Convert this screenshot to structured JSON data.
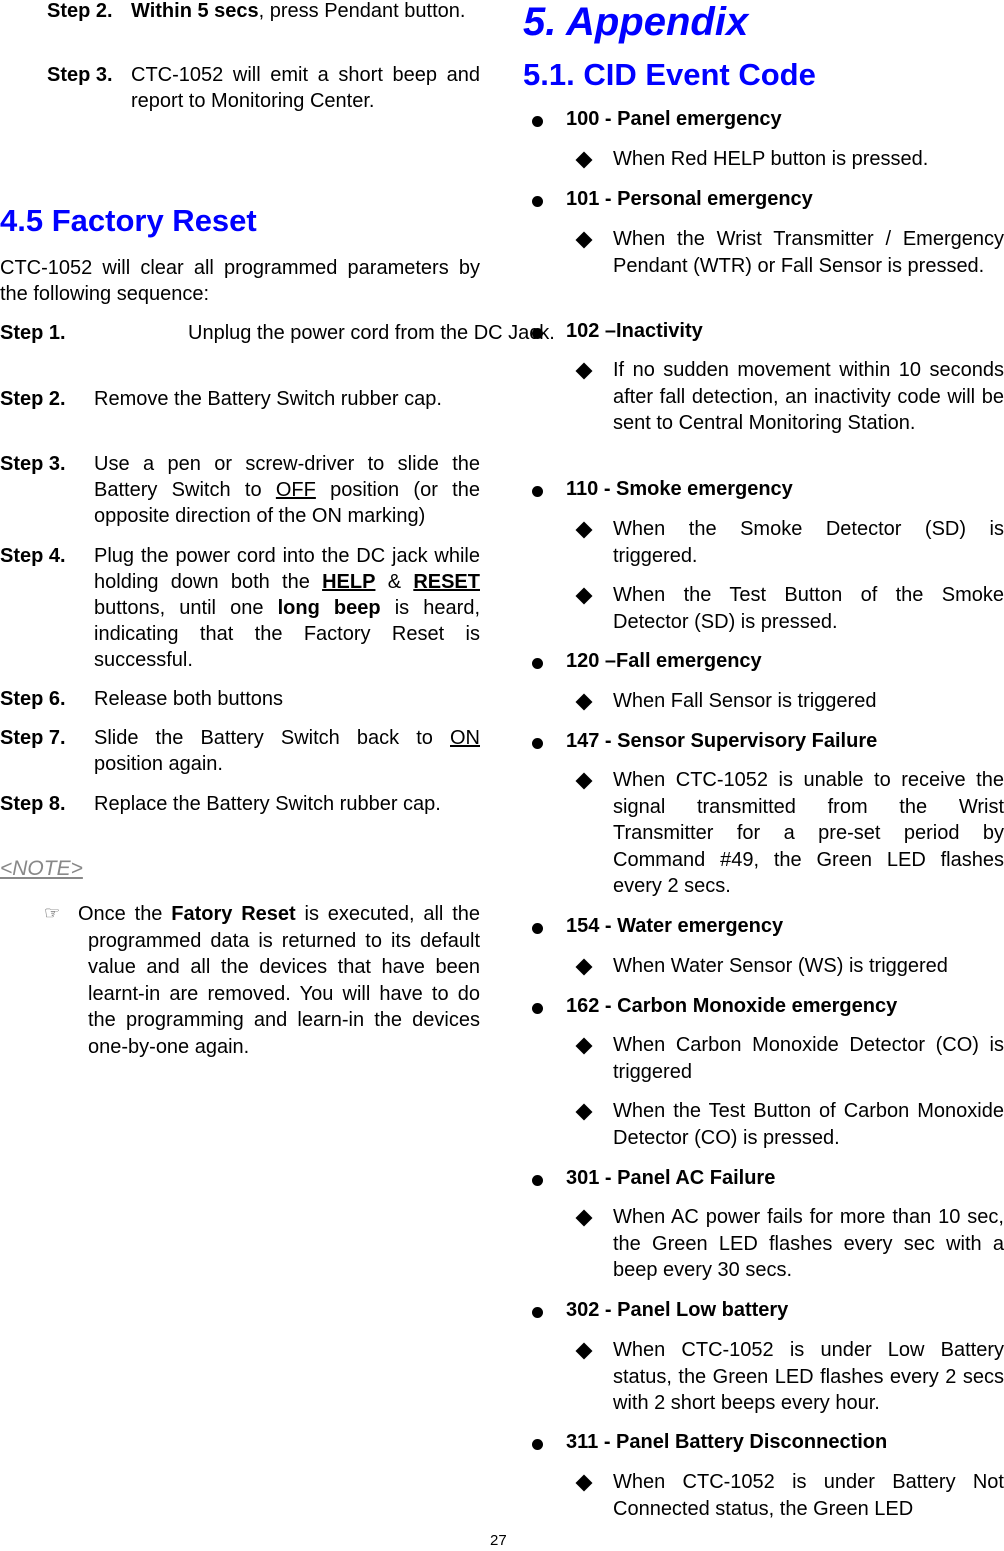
{
  "left_column": {
    "pendant_steps": [
      {
        "label": "Step 2.",
        "bold_text": "Within 5 secs",
        "text": ", press Pendant button."
      },
      {
        "label": "Step 3.",
        "text": "CTC-1052 will emit a short beep and report to Monitoring Center."
      }
    ],
    "factory_reset": {
      "heading": "4.5 Factory Reset",
      "intro": "CTC-1052 will clear all programmed parameters by the following sequence:",
      "steps": [
        {
          "label": "Step 1.",
          "text": "Unplug the power cord from the DC Jack."
        },
        {
          "label": "Step 2.",
          "text": "Remove the Battery Switch rubber cap."
        },
        {
          "label": "Step 3.",
          "text_before": "Use a pen or screw-driver to slide the Battery Switch to ",
          "underlined": "OFF",
          "text_after": " position (or the opposite direction of the ON marking)"
        },
        {
          "label": "Step 4.",
          "text_1": "Plug the power cord into the DC jack while holding down both the ",
          "bold_underlined_1": "HELP",
          "text_2": " & ",
          "bold_underlined_2": "RESET",
          "text_3": " buttons, until one ",
          "bold": "long beep",
          "text_4": " is heard, indicating that the Factory Reset is successful."
        },
        {
          "label": "Step 6.",
          "text": "Release both buttons"
        },
        {
          "label": "Step 7.",
          "text_before": "Slide the Battery Switch back to ",
          "underlined": "ON",
          "text_after": " position again."
        },
        {
          "label": "Step 8.",
          "text": "Replace the Battery Switch rubber cap."
        }
      ],
      "note": {
        "label": "<NOTE>",
        "icon": "pointing-hand-icon",
        "icon_glyph": "☞",
        "text_before": "Once the ",
        "bold": "Fatory Reset",
        "text_after": " is executed, all the programmed data is returned to its default value and all the devices that have been learnt-in are removed.  You will have to do the programming and learn-in the devices one-by-one again."
      }
    }
  },
  "right_column": {
    "heading": "5. Appendix",
    "subheading": "5.1. CID Event Code",
    "events": [
      {
        "title": "100 - Panel emergency",
        "descriptions": [
          "When Red HELP button is pressed."
        ]
      },
      {
        "title": "101 - Personal emergency",
        "descriptions": [
          "When the Wrist Transmitter / Emergency Pendant (WTR) or Fall Sensor is pressed."
        ]
      },
      {
        "title": "102 –Inactivity",
        "descriptions": [
          "If no sudden movement within 10 seconds after fall detection, an inactivity code will be sent to Central Monitoring Station."
        ]
      },
      {
        "title": "110 - Smoke emergency",
        "descriptions": [
          "When the Smoke Detector (SD) is triggered.",
          "When the Test Button of the Smoke Detector (SD) is pressed."
        ]
      },
      {
        "title": "120 –Fall emergency",
        "descriptions": [
          "When Fall Sensor is triggered"
        ]
      },
      {
        "title": "147 - Sensor Supervisory Failure",
        "descriptions": [
          "When CTC-1052 is unable to receive the signal transmitted from the Wrist Transmitter for a pre-set period by Command #49, the Green LED flashes every 2 secs."
        ]
      },
      {
        "title": "154 - Water emergency",
        "descriptions": [
          "When Water Sensor (WS) is triggered"
        ]
      },
      {
        "title": "162 - Carbon Monoxide emergency",
        "descriptions": [
          "When Carbon Monoxide Detector (CO) is triggered",
          "When the Test Button of Carbon Monoxide Detector (CO) is pressed."
        ]
      },
      {
        "title": "301 - Panel AC Failure",
        "descriptions": [
          "When AC power fails for more than 10 sec, the Green LED flashes every sec with a beep every 30 secs."
        ]
      },
      {
        "title": "302 - Panel Low battery",
        "descriptions": [
          "When CTC-1052 is under Low Battery status, the Green LED flashes every 2 secs with 2 short beeps every hour."
        ]
      },
      {
        "title": "311 - Panel Battery Disconnection",
        "descriptions": [
          "When CTC-1052 is under Battery Not Connected status, the Green LED"
        ]
      }
    ]
  },
  "footer": {
    "page_number": "27"
  },
  "colors": {
    "heading": "#0000ff",
    "note": "#888888",
    "text": "#000000"
  }
}
